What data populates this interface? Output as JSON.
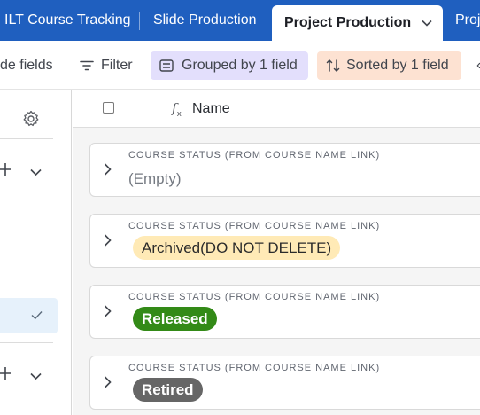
{
  "tabs": [
    {
      "label": "ILT Course Tracking",
      "active": false
    },
    {
      "label": "Slide Production",
      "active": false
    },
    {
      "label": "Project Production",
      "active": true
    },
    {
      "label": "Proj",
      "active": false
    }
  ],
  "toolbar": {
    "hide_fields_label": "de fields",
    "filter_label": "Filter",
    "grouped_label": "Grouped by 1 field",
    "sorted_label": "Sorted by 1 field",
    "more_label": "‹"
  },
  "grid": {
    "column_icon": "formula-icon",
    "column_name": "Name"
  },
  "groups": [
    {
      "field": "COURSE STATUS (FROM COURSE NAME LINK)",
      "value": "(Empty)"
    },
    {
      "field": "COURSE STATUS (FROM COURSE NAME LINK)",
      "value": "Archived(DO NOT DELETE)"
    },
    {
      "field": "COURSE STATUS (FROM COURSE NAME LINK)",
      "value": "Released"
    },
    {
      "field": "COURSE STATUS (FROM COURSE NAME LINK)",
      "value": "Retired"
    }
  ],
  "colors": {
    "tabbar": "#1f5fbf",
    "grouped_bg": "#e3dffc",
    "sorted_bg": "#fde2d2",
    "archived_pill": "#ffeab6",
    "released_pill": "#338a17",
    "retired_pill": "#666666"
  }
}
